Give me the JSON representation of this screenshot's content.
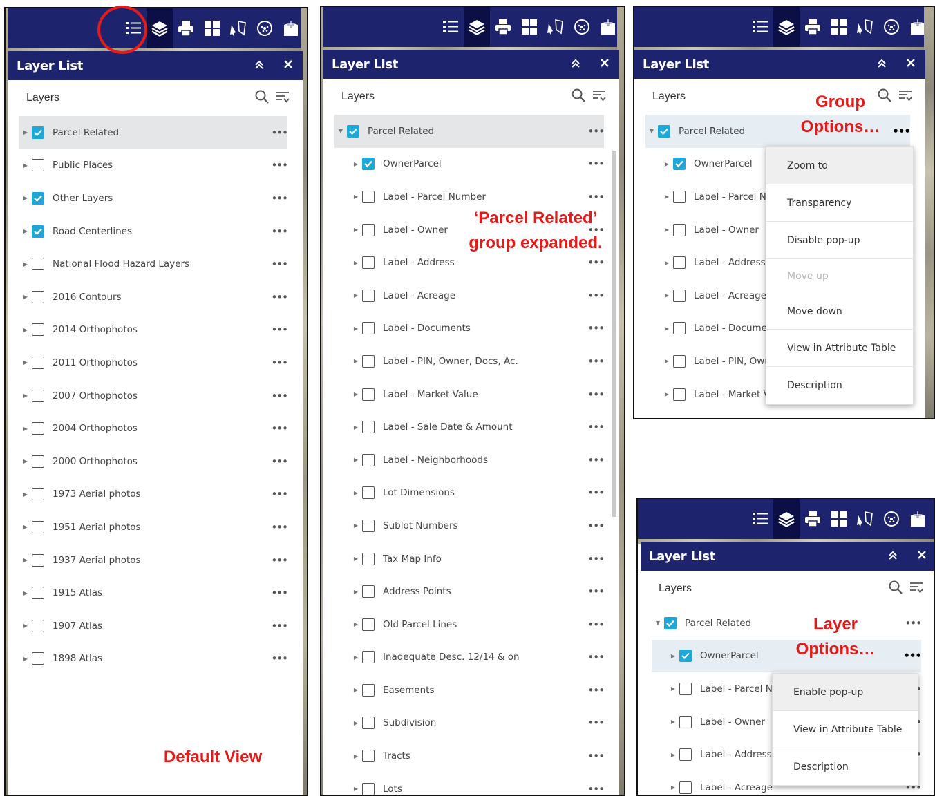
{
  "colors": {
    "header": "#1e236e",
    "checkbox": "#1fa7d7",
    "annotation": "#e21b1b"
  },
  "toolbar_icons": [
    "legend-icon",
    "layers-icon",
    "print-icon",
    "basemap-gallery-icon",
    "measurement-icon",
    "gps-icon",
    "bookmark-icon"
  ],
  "panel": {
    "title": "Layer List",
    "layers_label": "Layers",
    "collapse_icon": "double-chevron-up-icon",
    "close_icon": "close-icon"
  },
  "annotations": {
    "default_view": "Default View",
    "expanded_line1": "‘Parcel Related’",
    "expanded_line2": "group expanded.",
    "group_line1": "Group",
    "group_line2": "Options…",
    "layer_line1": "Layer",
    "layer_line2": "Options…"
  },
  "default_view": {
    "rows": [
      {
        "label": "Parcel Related",
        "checked": true
      },
      {
        "label": "Public Places",
        "checked": false
      },
      {
        "label": "Other Layers",
        "checked": true
      },
      {
        "label": "Road Centerlines",
        "checked": true
      },
      {
        "label": "National Flood Hazard Layers",
        "checked": false
      },
      {
        "label": "2016 Contours",
        "checked": false
      },
      {
        "label": "2014 Orthophotos",
        "checked": false
      },
      {
        "label": "2011 Orthophotos",
        "checked": false
      },
      {
        "label": "2007 Orthophotos",
        "checked": false
      },
      {
        "label": "2004 Orthophotos",
        "checked": false
      },
      {
        "label": "2000 Orthophotos",
        "checked": false
      },
      {
        "label": "1973 Aerial photos",
        "checked": false
      },
      {
        "label": "1951 Aerial photos",
        "checked": false
      },
      {
        "label": "1937 Aerial photos",
        "checked": false
      },
      {
        "label": "1915 Atlas",
        "checked": false
      },
      {
        "label": "1907 Atlas",
        "checked": false
      },
      {
        "label": "1898 Atlas",
        "checked": false
      }
    ]
  },
  "expanded_view": {
    "group": {
      "label": "Parcel Related",
      "checked": true
    },
    "rows": [
      {
        "label": "OwnerParcel",
        "checked": true
      },
      {
        "label": "Label - Parcel Number",
        "checked": false
      },
      {
        "label": "Label - Owner",
        "checked": false
      },
      {
        "label": "Label - Address",
        "checked": false
      },
      {
        "label": "Label - Acreage",
        "checked": false
      },
      {
        "label": "Label - Documents",
        "checked": false
      },
      {
        "label": "Label - PIN, Owner, Docs, Ac.",
        "checked": false
      },
      {
        "label": "Label - Market Value",
        "checked": false
      },
      {
        "label": "Label - Sale Date & Amount",
        "checked": false
      },
      {
        "label": "Label - Neighborhoods",
        "checked": false
      },
      {
        "label": "Lot Dimensions",
        "checked": false
      },
      {
        "label": "Sublot Numbers",
        "checked": false
      },
      {
        "label": "Tax Map Info",
        "checked": false
      },
      {
        "label": "Address Points",
        "checked": false
      },
      {
        "label": "Old Parcel Lines",
        "checked": false
      },
      {
        "label": "Inadequate Desc. 12/14 & on",
        "checked": false
      },
      {
        "label": "Easements",
        "checked": false
      },
      {
        "label": "Subdivision",
        "checked": false
      },
      {
        "label": "Tracts",
        "checked": false
      },
      {
        "label": "Lots",
        "checked": false
      }
    ]
  },
  "group_options_view": {
    "group": {
      "label": "Parcel Related",
      "checked": true
    },
    "rows": [
      {
        "label": "OwnerParcel",
        "checked": true
      },
      {
        "label": "Label - Parcel Nu",
        "checked": false
      },
      {
        "label": "Label - Owner",
        "checked": false
      },
      {
        "label": "Label - Address",
        "checked": false
      },
      {
        "label": "Label - Acreage",
        "checked": false
      },
      {
        "label": "Label - Documer",
        "checked": false
      },
      {
        "label": "Label - PIN, Own",
        "checked": false
      },
      {
        "label": "Label - Market Va",
        "checked": false
      }
    ],
    "menu": [
      {
        "label": "Zoom to",
        "state": "highlighted"
      },
      {
        "label": "Transparency",
        "state": "normal"
      },
      {
        "label": "Disable pop-up",
        "state": "normal"
      },
      {
        "label": "Move up",
        "state": "disabled"
      },
      {
        "label": "Move down",
        "state": "normal"
      },
      {
        "label": "View in Attribute Table",
        "state": "normal"
      },
      {
        "label": "Description",
        "state": "normal"
      }
    ]
  },
  "layer_options_view": {
    "group": {
      "label": "Parcel Related",
      "checked": true
    },
    "rows": [
      {
        "label": "OwnerParcel",
        "checked": true
      },
      {
        "label": "Label - Parcel Nu",
        "checked": false
      },
      {
        "label": "Label - Owner",
        "checked": false
      },
      {
        "label": "Label - Address",
        "checked": false
      },
      {
        "label": "Label - Acreage",
        "checked": false
      }
    ],
    "menu": [
      {
        "label": "Enable pop-up",
        "state": "highlighted"
      },
      {
        "label": "View in Attribute Table",
        "state": "normal"
      },
      {
        "label": "Description",
        "state": "normal"
      }
    ]
  }
}
